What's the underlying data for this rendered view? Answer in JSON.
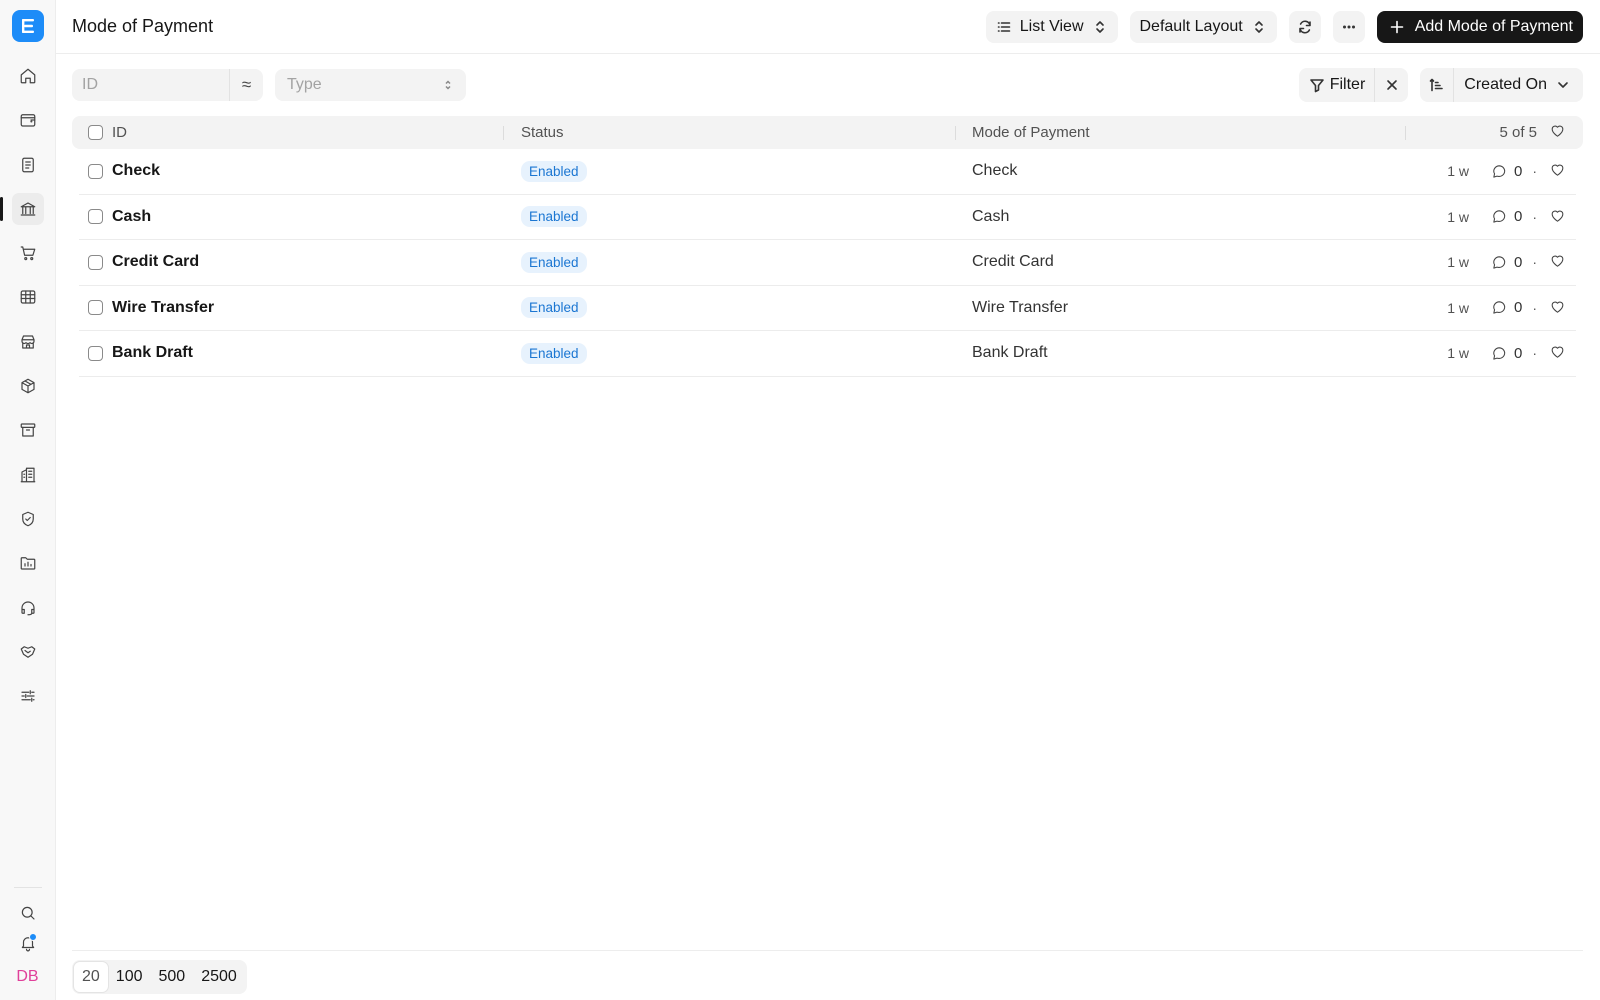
{
  "header": {
    "title": "Mode of Payment",
    "view_label": "List View",
    "layout_label": "Default Layout",
    "add_label": "Add Mode of Payment"
  },
  "sidebar": {
    "items": [
      {
        "icon": "home-icon"
      },
      {
        "icon": "wallet-icon"
      },
      {
        "icon": "document-icon"
      },
      {
        "icon": "bank-icon",
        "active": true
      },
      {
        "icon": "cart-icon"
      },
      {
        "icon": "table-icon"
      },
      {
        "icon": "store-icon"
      },
      {
        "icon": "package-icon"
      },
      {
        "icon": "archive-icon"
      },
      {
        "icon": "building-icon"
      },
      {
        "icon": "shield-icon"
      },
      {
        "icon": "folder-chart-icon"
      },
      {
        "icon": "headset-icon"
      },
      {
        "icon": "handshake-icon"
      },
      {
        "icon": "sliders-icon"
      }
    ],
    "avatar_initials": "DB"
  },
  "filters": {
    "id_placeholder": "ID",
    "type_placeholder": "Type",
    "filter_label": "Filter",
    "sort_label": "Created On"
  },
  "table": {
    "columns": [
      "ID",
      "Status",
      "Mode of Payment"
    ],
    "count_label": "5 of 5",
    "rows": [
      {
        "id": "Check",
        "status": "Enabled",
        "mode": "Check",
        "age": "1 w",
        "comments": "0"
      },
      {
        "id": "Cash",
        "status": "Enabled",
        "mode": "Cash",
        "age": "1 w",
        "comments": "0"
      },
      {
        "id": "Credit Card",
        "status": "Enabled",
        "mode": "Credit Card",
        "age": "1 w",
        "comments": "0"
      },
      {
        "id": "Wire Transfer",
        "status": "Enabled",
        "mode": "Wire Transfer",
        "age": "1 w",
        "comments": "0"
      },
      {
        "id": "Bank Draft",
        "status": "Enabled",
        "mode": "Bank Draft",
        "age": "1 w",
        "comments": "0"
      }
    ]
  },
  "pagination": {
    "sizes": [
      "20",
      "100",
      "500",
      "2500"
    ],
    "selected": "20"
  },
  "colors": {
    "accent": "#1d8cf8",
    "primary_button": "#171717",
    "badge_bg": "#e7f2fd",
    "badge_text": "#1b76d2",
    "avatar_text": "#e0409a"
  }
}
